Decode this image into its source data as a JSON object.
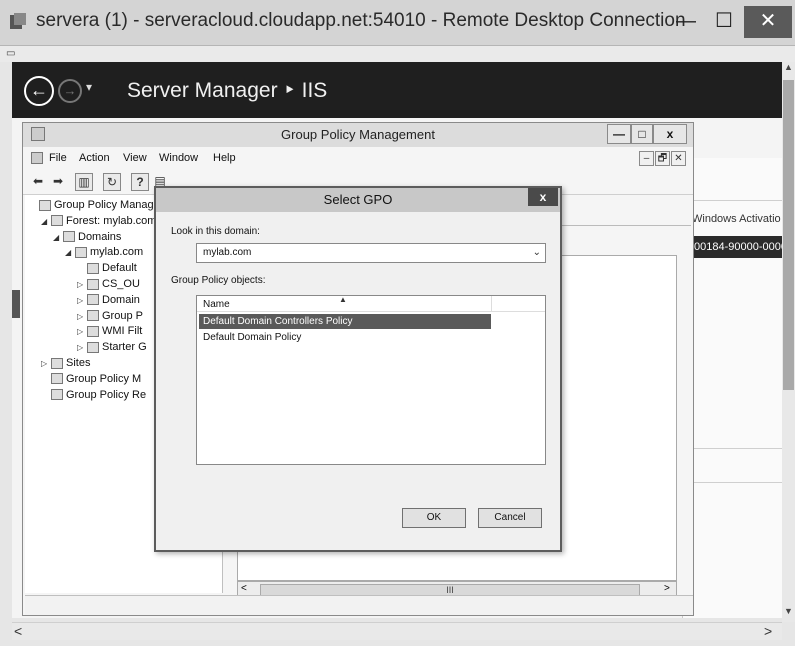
{
  "rdp": {
    "title": "servera (1) - serveracloud.cloudapp.net:54010 - Remote Desktop Connection",
    "minimize": "—",
    "maximize": "☐",
    "close": "✕"
  },
  "server_manager": {
    "title": "Server Manager ‣ IIS",
    "right_column_header": "Windows Activatio",
    "right_row_value": "00184-90000-0000"
  },
  "gpm": {
    "title": "Group Policy Management",
    "minimize": "—",
    "maximize": "□",
    "close": "x",
    "menu": [
      "File",
      "Action",
      "View",
      "Window",
      "Help"
    ],
    "mdi_min": "–",
    "mdi_restore": "🗗",
    "mdi_close": "✕",
    "tree": [
      {
        "label": "Group Policy Manager",
        "indent": 0,
        "arrow": ""
      },
      {
        "label": "Forest: mylab.com",
        "indent": 1,
        "arrow": "◢"
      },
      {
        "label": "Domains",
        "indent": 2,
        "arrow": "◢"
      },
      {
        "label": "mylab.com",
        "indent": 3,
        "arrow": "◢"
      },
      {
        "label": "Default",
        "indent": 4,
        "arrow": ""
      },
      {
        "label": "CS_OU",
        "indent": 4,
        "arrow": "▷"
      },
      {
        "label": "Domain",
        "indent": 4,
        "arrow": "▷"
      },
      {
        "label": "Group P",
        "indent": 4,
        "arrow": "▷"
      },
      {
        "label": "WMI Filt",
        "indent": 4,
        "arrow": "▷"
      },
      {
        "label": "Starter G",
        "indent": 4,
        "arrow": "▷"
      },
      {
        "label": "Sites",
        "indent": 1,
        "arrow": "▷"
      },
      {
        "label": "Group Policy M",
        "indent": 1,
        "arrow": ""
      },
      {
        "label": "Group Policy Re",
        "indent": 1,
        "arrow": ""
      }
    ],
    "hscroll_glyph": "III",
    "hscroll_left": "<",
    "hscroll_right": ">"
  },
  "dialog": {
    "title": "Select GPO",
    "close": "x",
    "look_in_label": "Look in this domain:",
    "domain_value": "mylab.com",
    "gpo_label": "Group Policy objects:",
    "col_name": "Name",
    "rows": [
      "Default Domain Controllers Policy",
      "Default Domain Policy"
    ],
    "ok": "OK",
    "cancel": "Cancel"
  }
}
